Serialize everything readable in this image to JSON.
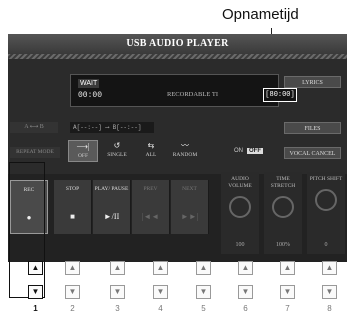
{
  "callout": "Opnametijd",
  "title": "USB AUDIO PLAYER",
  "display": {
    "status": "WAIT",
    "time": "00:00",
    "recordable_label": "RECORDABLE TI",
    "recordable_time": "[80:00]"
  },
  "side_buttons": [
    "LYRICS",
    "FILES",
    "VOCAL CANCEL"
  ],
  "ab_repeat": {
    "label": "A ⟷ B",
    "range": "A[--:--] ⟶ B[--:--]"
  },
  "repeat_mode": {
    "label": "REPEAT MODE",
    "options": [
      {
        "label": "OFF",
        "glyph": "⟶|"
      },
      {
        "label": "SINGLE",
        "glyph": "↺"
      },
      {
        "label": "ALL",
        "glyph": "⇆"
      },
      {
        "label": "RANDOM",
        "glyph": "〰"
      }
    ]
  },
  "vocal_toggle": {
    "on": "ON",
    "off": "OFF"
  },
  "transport": [
    {
      "label": "REC",
      "glyph": "●"
    },
    {
      "label": "STOP",
      "glyph": "■"
    },
    {
      "label": "PLAY/ PAUSE",
      "glyph": "►/II"
    },
    {
      "label": "PREV",
      "glyph": "|◄◄"
    },
    {
      "label": "NEXT",
      "glyph": "►►|"
    }
  ],
  "dials": [
    {
      "label": "AUDIO VOLUME",
      "value": "100"
    },
    {
      "label": "TIME STRETCH",
      "value": "100%"
    },
    {
      "label": "PITCH SHIFT",
      "value": "0"
    }
  ],
  "hw_buttons": {
    "numbers": [
      "1",
      "2",
      "3",
      "4",
      "5",
      "6",
      "7",
      "8"
    ],
    "up_glyph": "▲",
    "down_glyph": "▼"
  }
}
